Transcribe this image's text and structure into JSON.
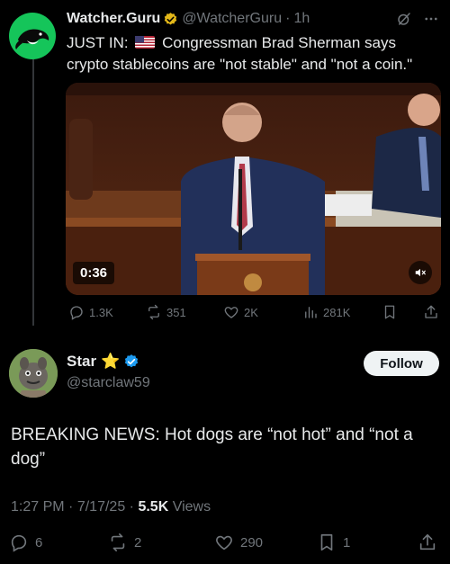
{
  "quoted_tweet": {
    "author_name": "Watcher.Guru",
    "author_handle": "@WatcherGuru",
    "separator": "·",
    "time_ago": "1h",
    "text_prefix": "JUST IN:",
    "text_body": "Congressman Brad Sherman says crypto stablecoins are \"not stable\" and \"not a coin.\"",
    "video_duration": "0:36",
    "replies": "1.3K",
    "reposts": "351",
    "likes": "2K",
    "views": "281K"
  },
  "main_tweet": {
    "author_name": "Star",
    "author_emoji": "⭐",
    "author_handle": "@starclaw59",
    "follow_label": "Follow",
    "text": "BREAKING NEWS: Hot dogs are “not hot” and “not a dog”",
    "time": "1:27 PM",
    "date": "7/17/25",
    "dot": "·",
    "views_count": "5.5K",
    "views_label": "Views",
    "replies": "6",
    "reposts": "2",
    "likes": "290",
    "bookmarks": "1"
  },
  "colors": {
    "background": "#000000",
    "text": "#e7e9ea",
    "muted": "#71767b",
    "verified_blue": "#1d9bf0",
    "verified_gold": "#e2b719",
    "watcher_green": "#15c55a"
  }
}
